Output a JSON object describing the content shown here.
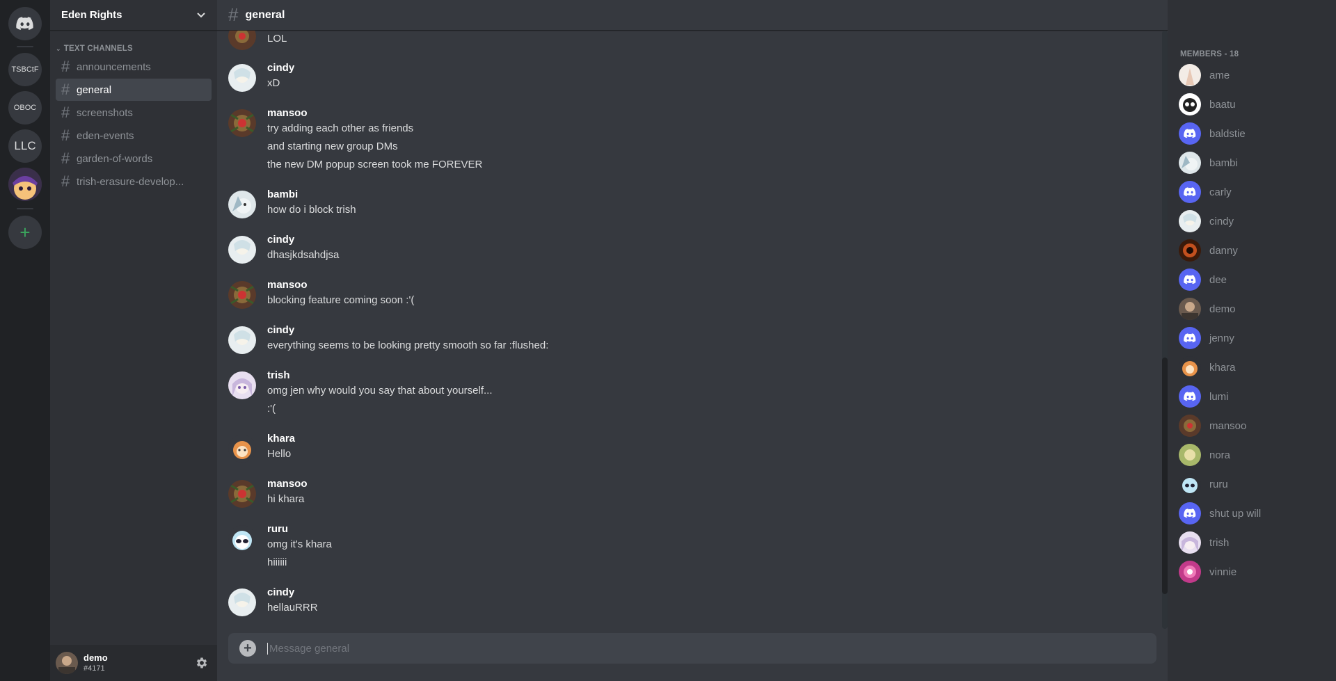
{
  "servers": [
    {
      "label": "",
      "icon": "discord-logo-icon"
    },
    {
      "label": "TSBCtF"
    },
    {
      "label": "OBOC"
    },
    {
      "label": "LLC"
    },
    {
      "label": "",
      "icon": "server-image-icon"
    },
    {
      "label": "+"
    }
  ],
  "guild": {
    "name": "Eden Rights"
  },
  "category": "TEXT CHANNELS",
  "channels": [
    {
      "name": "announcements"
    },
    {
      "name": "general"
    },
    {
      "name": "screenshots"
    },
    {
      "name": "eden-events"
    },
    {
      "name": "garden-of-words"
    },
    {
      "name": "trish-erasure-develop..."
    }
  ],
  "current_user": {
    "name": "demo",
    "tag": "#4171"
  },
  "channel_header": {
    "title": "general"
  },
  "messages": [
    {
      "author": "",
      "lines": [
        "LOL"
      ]
    },
    {
      "author": "cindy",
      "lines": [
        "xD"
      ]
    },
    {
      "author": "mansoo",
      "lines": [
        "try adding each other as friends",
        "and starting new group DMs",
        "the new DM popup screen took me FOREVER"
      ]
    },
    {
      "author": "bambi",
      "lines": [
        "how do i block trish"
      ]
    },
    {
      "author": "cindy",
      "lines": [
        "dhasjkdsahdjsa"
      ]
    },
    {
      "author": "mansoo",
      "lines": [
        "blocking feature coming soon :'("
      ]
    },
    {
      "author": "cindy",
      "lines": [
        "everything seems to be looking pretty smooth so far :flushed:"
      ]
    },
    {
      "author": "trish",
      "lines": [
        "omg jen why would you say that about yourself...",
        ":'("
      ]
    },
    {
      "author": "khara",
      "lines": [
        "Hello"
      ]
    },
    {
      "author": "mansoo",
      "lines": [
        "hi khara"
      ]
    },
    {
      "author": "ruru",
      "lines": [
        "omg it's khara",
        "hiiiiii"
      ]
    },
    {
      "author": "cindy",
      "lines": [
        "hellauRRR"
      ]
    }
  ],
  "composer": {
    "placeholder": "Message general"
  },
  "members_header": "MEMBERS - 18",
  "members": [
    {
      "name": "ame"
    },
    {
      "name": "baatu"
    },
    {
      "name": "baldstie"
    },
    {
      "name": "bambi"
    },
    {
      "name": "carly"
    },
    {
      "name": "cindy"
    },
    {
      "name": "danny"
    },
    {
      "name": "dee"
    },
    {
      "name": "demo"
    },
    {
      "name": "jenny"
    },
    {
      "name": "khara"
    },
    {
      "name": "lumi"
    },
    {
      "name": "mansoo"
    },
    {
      "name": "nora"
    },
    {
      "name": "ruru"
    },
    {
      "name": "shut up will"
    },
    {
      "name": "trish"
    },
    {
      "name": "vinnie"
    }
  ],
  "colors": {
    "blurple": "#5865f2",
    "bg_main": "#36393f",
    "bg_side": "#2f3136",
    "bg_rail": "#202225",
    "green": "#3ba55d"
  }
}
